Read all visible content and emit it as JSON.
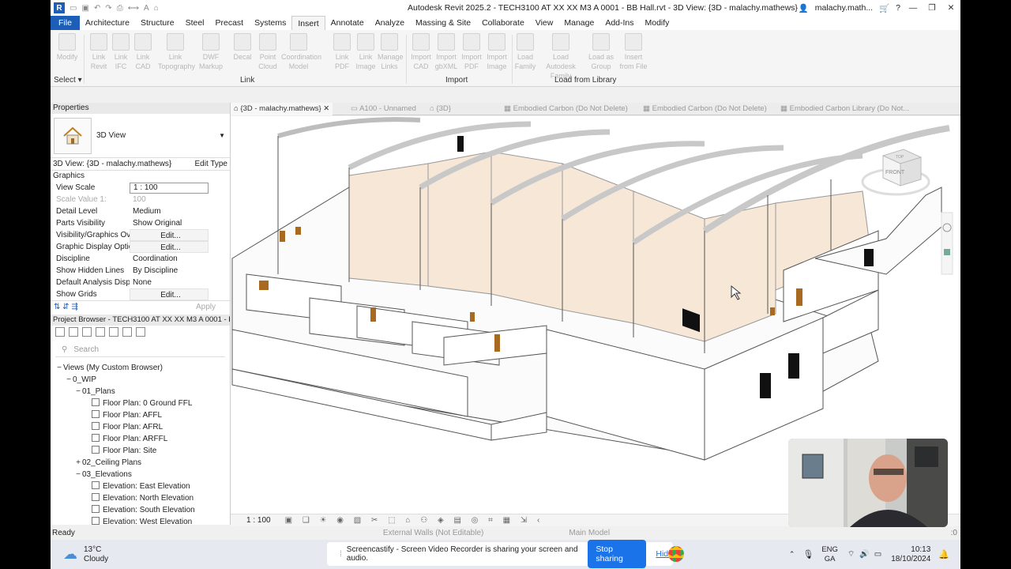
{
  "title_bar": {
    "title": "Autodesk Revit 2025.2 - TECH3100 AT XX XX M3 A 0001 - BB Hall.rvt - 3D View: {3D - malachy.mathews}",
    "user": "malachy.math..."
  },
  "menu": [
    "File",
    "Architecture",
    "Structure",
    "Steel",
    "Precast",
    "Systems",
    "Insert",
    "Annotate",
    "Analyze",
    "Massing & Site",
    "Collaborate",
    "View",
    "Manage",
    "Add-Ins",
    "Modify"
  ],
  "ribbon": {
    "buttons": [
      "Modify",
      "Link Revit",
      "Link IFC",
      "Link CAD",
      "Link Topography",
      "DWF Markup",
      "Decal",
      "Point Cloud",
      "Coordination Model",
      "Link PDF",
      "Link Image",
      "Manage Links",
      "Import CAD",
      "Import gbXML",
      "Import PDF",
      "Import Image",
      "Load Family",
      "Load Autodesk Family",
      "Load as Group",
      "Insert from File"
    ],
    "panels": {
      "select": "Select",
      "link": "Link",
      "import": "Import",
      "load": "Load from Library"
    }
  },
  "properties": {
    "header": "Properties",
    "type_name": "3D View",
    "selector": "3D View: {3D - malachy.mathews}",
    "edit_type": "Edit Type",
    "group": "Graphics",
    "rows": [
      {
        "k": "View Scale",
        "v": "1 : 100"
      },
      {
        "k": "Scale Value    1:",
        "v": "100"
      },
      {
        "k": "Detail Level",
        "v": "Medium"
      },
      {
        "k": "Parts Visibility",
        "v": "Show Original"
      },
      {
        "k": "Visibility/Graphics Ov...",
        "v": "Edit..."
      },
      {
        "k": "Graphic Display Optio...",
        "v": "Edit..."
      },
      {
        "k": "Discipline",
        "v": "Coordination"
      },
      {
        "k": "Show Hidden Lines",
        "v": "By Discipline"
      },
      {
        "k": "Default Analysis Displ...",
        "v": "None"
      },
      {
        "k": "Show Grids",
        "v": "Edit..."
      }
    ],
    "apply": "Apply"
  },
  "project_browser": {
    "header": "Project Browser - TECH3100 AT XX XX M3 A 0001 - BB...",
    "search": "Search",
    "tree": [
      {
        "t": "Views (My Custom Browser)",
        "lvl": 0,
        "tog": "−"
      },
      {
        "t": "0_WIP",
        "lvl": 1,
        "tog": "−"
      },
      {
        "t": "01_Plans",
        "lvl": 2,
        "tog": "−"
      },
      {
        "t": "Floor Plan: 0 Ground FFL",
        "lvl": 3,
        "tog": ""
      },
      {
        "t": "Floor Plan: AFFL",
        "lvl": 3,
        "tog": ""
      },
      {
        "t": "Floor Plan: AFRL",
        "lvl": 3,
        "tog": ""
      },
      {
        "t": "Floor Plan: ARFFL",
        "lvl": 3,
        "tog": ""
      },
      {
        "t": "Floor Plan: Site",
        "lvl": 3,
        "tog": ""
      },
      {
        "t": "02_Ceiling Plans",
        "lvl": 2,
        "tog": "+"
      },
      {
        "t": "03_Elevations",
        "lvl": 2,
        "tog": "−"
      },
      {
        "t": "Elevation: East Elevation",
        "lvl": 3,
        "tog": ""
      },
      {
        "t": "Elevation: North Elevation",
        "lvl": 3,
        "tog": ""
      },
      {
        "t": "Elevation: South Elevation",
        "lvl": 3,
        "tog": ""
      },
      {
        "t": "Elevation: West Elevation",
        "lvl": 3,
        "tog": ""
      }
    ]
  },
  "tabs": [
    "{3D - malachy.mathews}",
    "A100 - Unnamed",
    "{3D}",
    "Embodied Carbon (Do Not Delete)",
    "Embodied Carbon (Do Not Delete)",
    "Embodied Carbon Library (Do Not..."
  ],
  "view_control": {
    "scale": "1 : 100"
  },
  "viewcube": {
    "front": "FRONT",
    "top": "TOP"
  },
  "status": {
    "ready": "Ready",
    "walls": "External Walls (Not Editable)",
    "model": "Main Model",
    "zero": ":0"
  },
  "taskbar": {
    "temp": "13°C",
    "weather": "Cloudy",
    "lang1": "ENG",
    "lang2": "GA",
    "time": "10:13",
    "date": "18/10/2024"
  },
  "share": {
    "message": "Screencastify - Screen Video Recorder is sharing your screen and audio.",
    "stop": "Stop sharing",
    "hide": "Hide"
  }
}
